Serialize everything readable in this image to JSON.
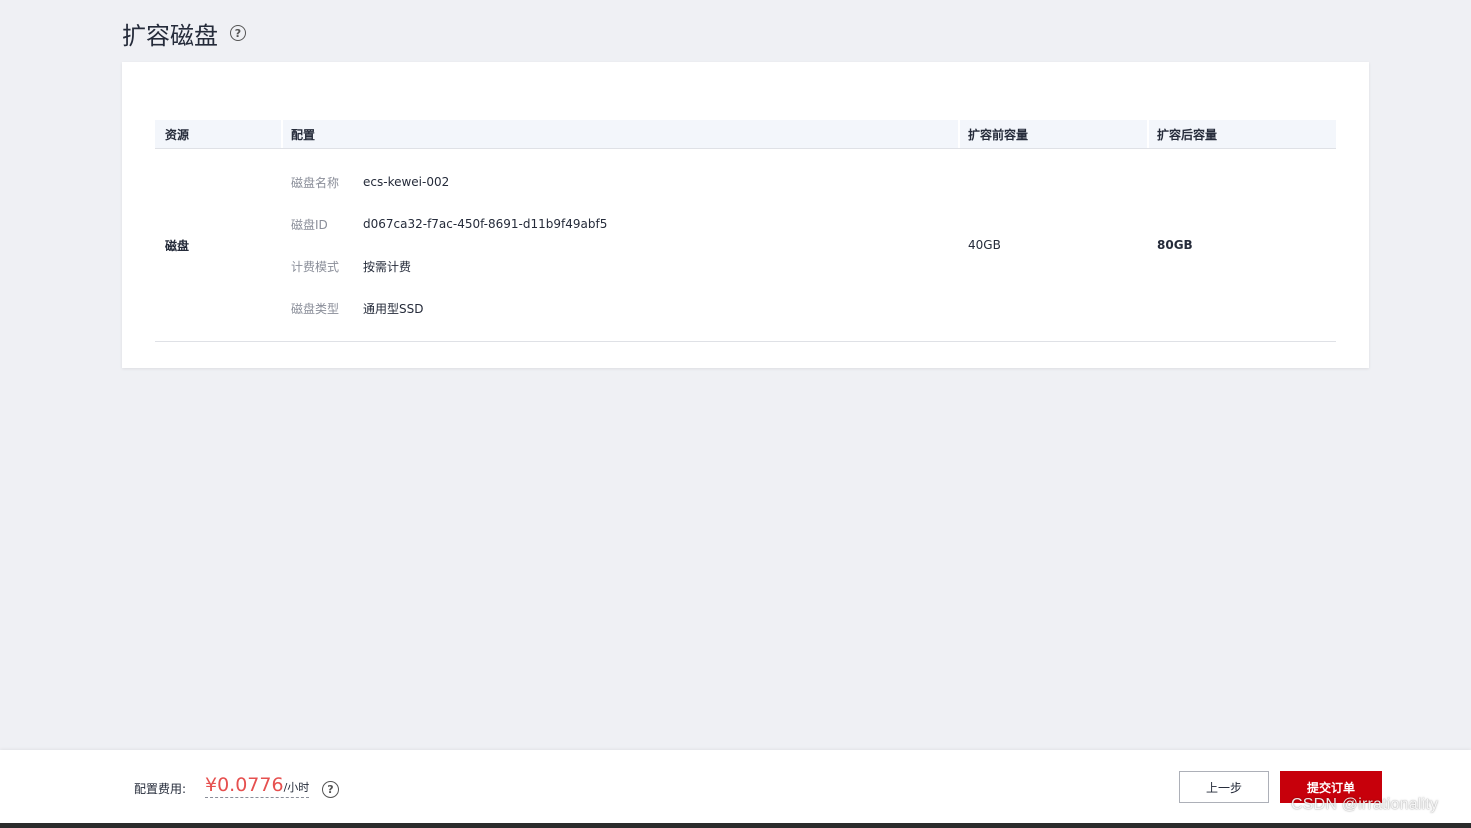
{
  "page": {
    "title": "扩容磁盘",
    "help_glyph": "?"
  },
  "table": {
    "headers": {
      "resource": "资源",
      "config": "配置",
      "before": "扩容前容量",
      "after": "扩容后容量"
    },
    "row": {
      "resource": "磁盘",
      "config": [
        {
          "label": "磁盘名称",
          "value": "ecs-kewei-002"
        },
        {
          "label": "磁盘ID",
          "value": "d067ca32-f7ac-450f-8691-d11b9f49abf5"
        },
        {
          "label": "计费模式",
          "value": "按需计费"
        },
        {
          "label": "磁盘类型",
          "value": "通用型SSD"
        }
      ],
      "before": "40GB",
      "after": "80GB"
    }
  },
  "footer": {
    "fee_label": "配置费用:",
    "fee_price": "¥0.0776",
    "fee_unit": "/小时",
    "help_glyph": "?",
    "prev_label": "上一步",
    "submit_label": "提交订单",
    "submit_color": "#c7000b",
    "price_color": "#e6504f"
  },
  "watermark": "CSDN @irrationality"
}
